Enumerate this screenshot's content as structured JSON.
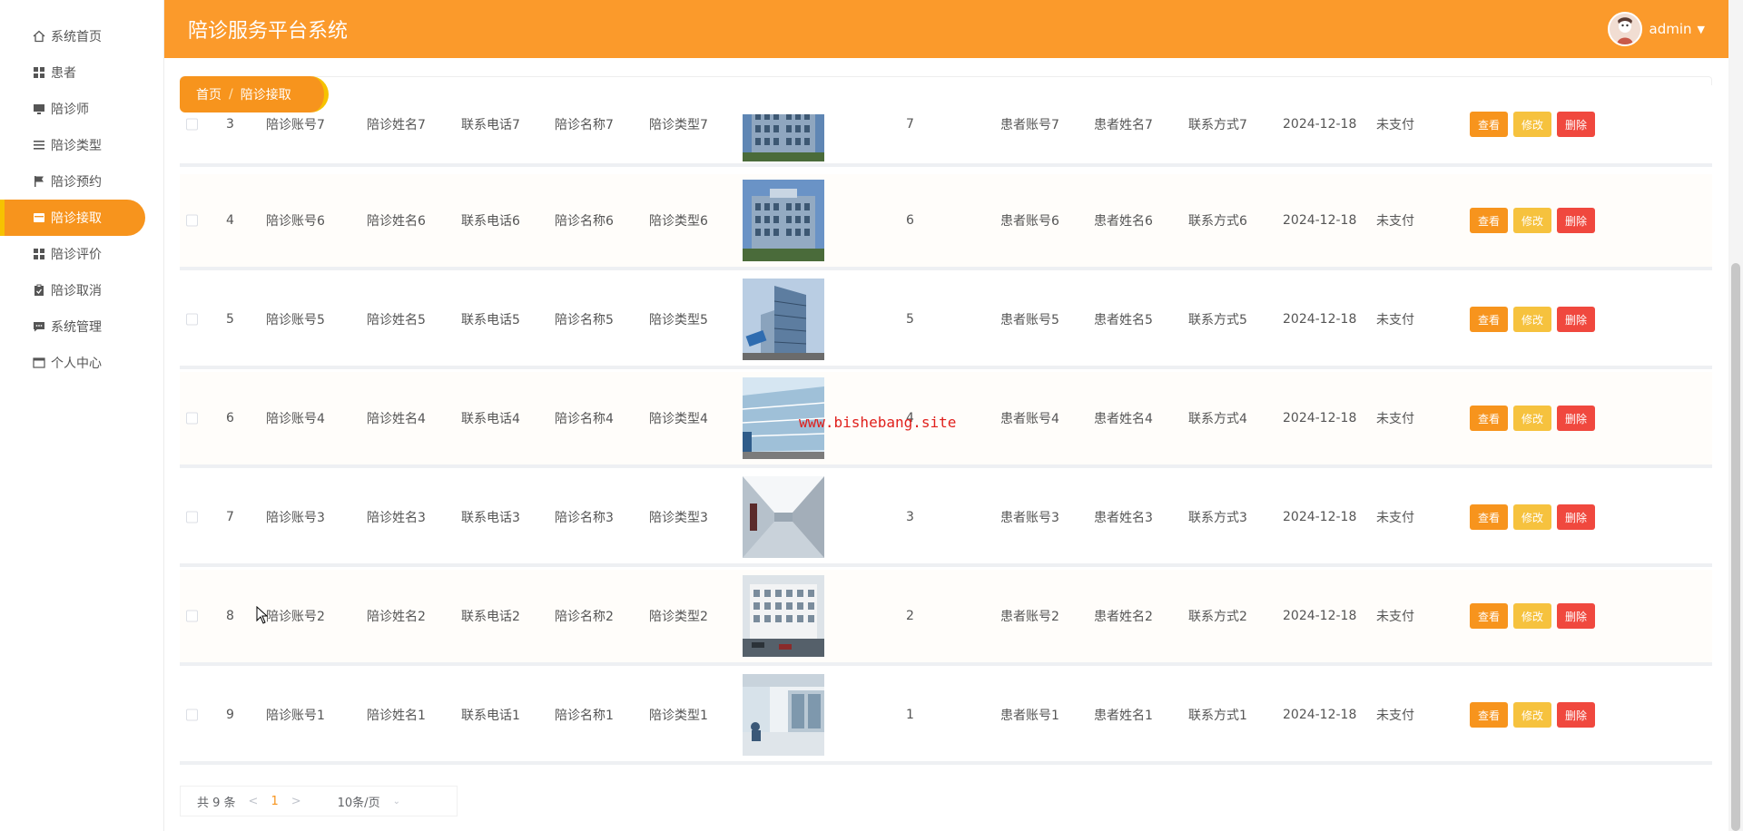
{
  "app": {
    "title": "陪诊服务平台系统",
    "user": "admin"
  },
  "sidebar": {
    "items": [
      {
        "label": "系统首页",
        "icon": "home-icon"
      },
      {
        "label": "患者",
        "icon": "grid-icon"
      },
      {
        "label": "陪诊师",
        "icon": "monitor-icon"
      },
      {
        "label": "陪诊类型",
        "icon": "list-icon"
      },
      {
        "label": "陪诊预约",
        "icon": "flag-icon"
      },
      {
        "label": "陪诊接取",
        "icon": "card-icon",
        "active": true
      },
      {
        "label": "陪诊评价",
        "icon": "grid-icon"
      },
      {
        "label": "陪诊取消",
        "icon": "clipboard-icon"
      },
      {
        "label": "系统管理",
        "icon": "chat-icon"
      },
      {
        "label": "个人中心",
        "icon": "window-icon"
      }
    ]
  },
  "breadcrumb": {
    "home": "首页",
    "sep": "/",
    "current": "陪诊接取"
  },
  "watermark": "www.bishebang.site",
  "actions": {
    "view": "查看",
    "edit": "修改",
    "delete": "删除"
  },
  "rows": [
    {
      "index": "3",
      "account": "陪诊账号7",
      "name": "陪诊姓名7",
      "phone": "联系电话7",
      "service": "陪诊名称7",
      "type": "陪诊类型7",
      "count": "7",
      "patient_account": "患者账号7",
      "patient_name": "患者姓名7",
      "contact": "联系方式7",
      "date": "2024-12-18",
      "status": "未支付"
    },
    {
      "index": "4",
      "account": "陪诊账号6",
      "name": "陪诊姓名6",
      "phone": "联系电话6",
      "service": "陪诊名称6",
      "type": "陪诊类型6",
      "count": "6",
      "patient_account": "患者账号6",
      "patient_name": "患者姓名6",
      "contact": "联系方式6",
      "date": "2024-12-18",
      "status": "未支付"
    },
    {
      "index": "5",
      "account": "陪诊账号5",
      "name": "陪诊姓名5",
      "phone": "联系电话5",
      "service": "陪诊名称5",
      "type": "陪诊类型5",
      "count": "5",
      "patient_account": "患者账号5",
      "patient_name": "患者姓名5",
      "contact": "联系方式5",
      "date": "2024-12-18",
      "status": "未支付"
    },
    {
      "index": "6",
      "account": "陪诊账号4",
      "name": "陪诊姓名4",
      "phone": "联系电话4",
      "service": "陪诊名称4",
      "type": "陪诊类型4",
      "count": "4",
      "patient_account": "患者账号4",
      "patient_name": "患者姓名4",
      "contact": "联系方式4",
      "date": "2024-12-18",
      "status": "未支付"
    },
    {
      "index": "7",
      "account": "陪诊账号3",
      "name": "陪诊姓名3",
      "phone": "联系电话3",
      "service": "陪诊名称3",
      "type": "陪诊类型3",
      "count": "3",
      "patient_account": "患者账号3",
      "patient_name": "患者姓名3",
      "contact": "联系方式3",
      "date": "2024-12-18",
      "status": "未支付"
    },
    {
      "index": "8",
      "account": "陪诊账号2",
      "name": "陪诊姓名2",
      "phone": "联系电话2",
      "service": "陪诊名称2",
      "type": "陪诊类型2",
      "count": "2",
      "patient_account": "患者账号2",
      "patient_name": "患者姓名2",
      "contact": "联系方式2",
      "date": "2024-12-18",
      "status": "未支付"
    },
    {
      "index": "9",
      "account": "陪诊账号1",
      "name": "陪诊姓名1",
      "phone": "联系电话1",
      "service": "陪诊名称1",
      "type": "陪诊类型1",
      "count": "1",
      "patient_account": "患者账号1",
      "patient_name": "患者姓名1",
      "contact": "联系方式1",
      "date": "2024-12-18",
      "status": "未支付"
    }
  ],
  "pagination": {
    "total": "共 9 条",
    "prev": "<",
    "page": "1",
    "next": ">",
    "page_size": "10条/页"
  },
  "colors": {
    "accent": "#fb9a2b",
    "active": "#f7941d",
    "edit": "#f6c23e",
    "delete": "#f0483e"
  }
}
